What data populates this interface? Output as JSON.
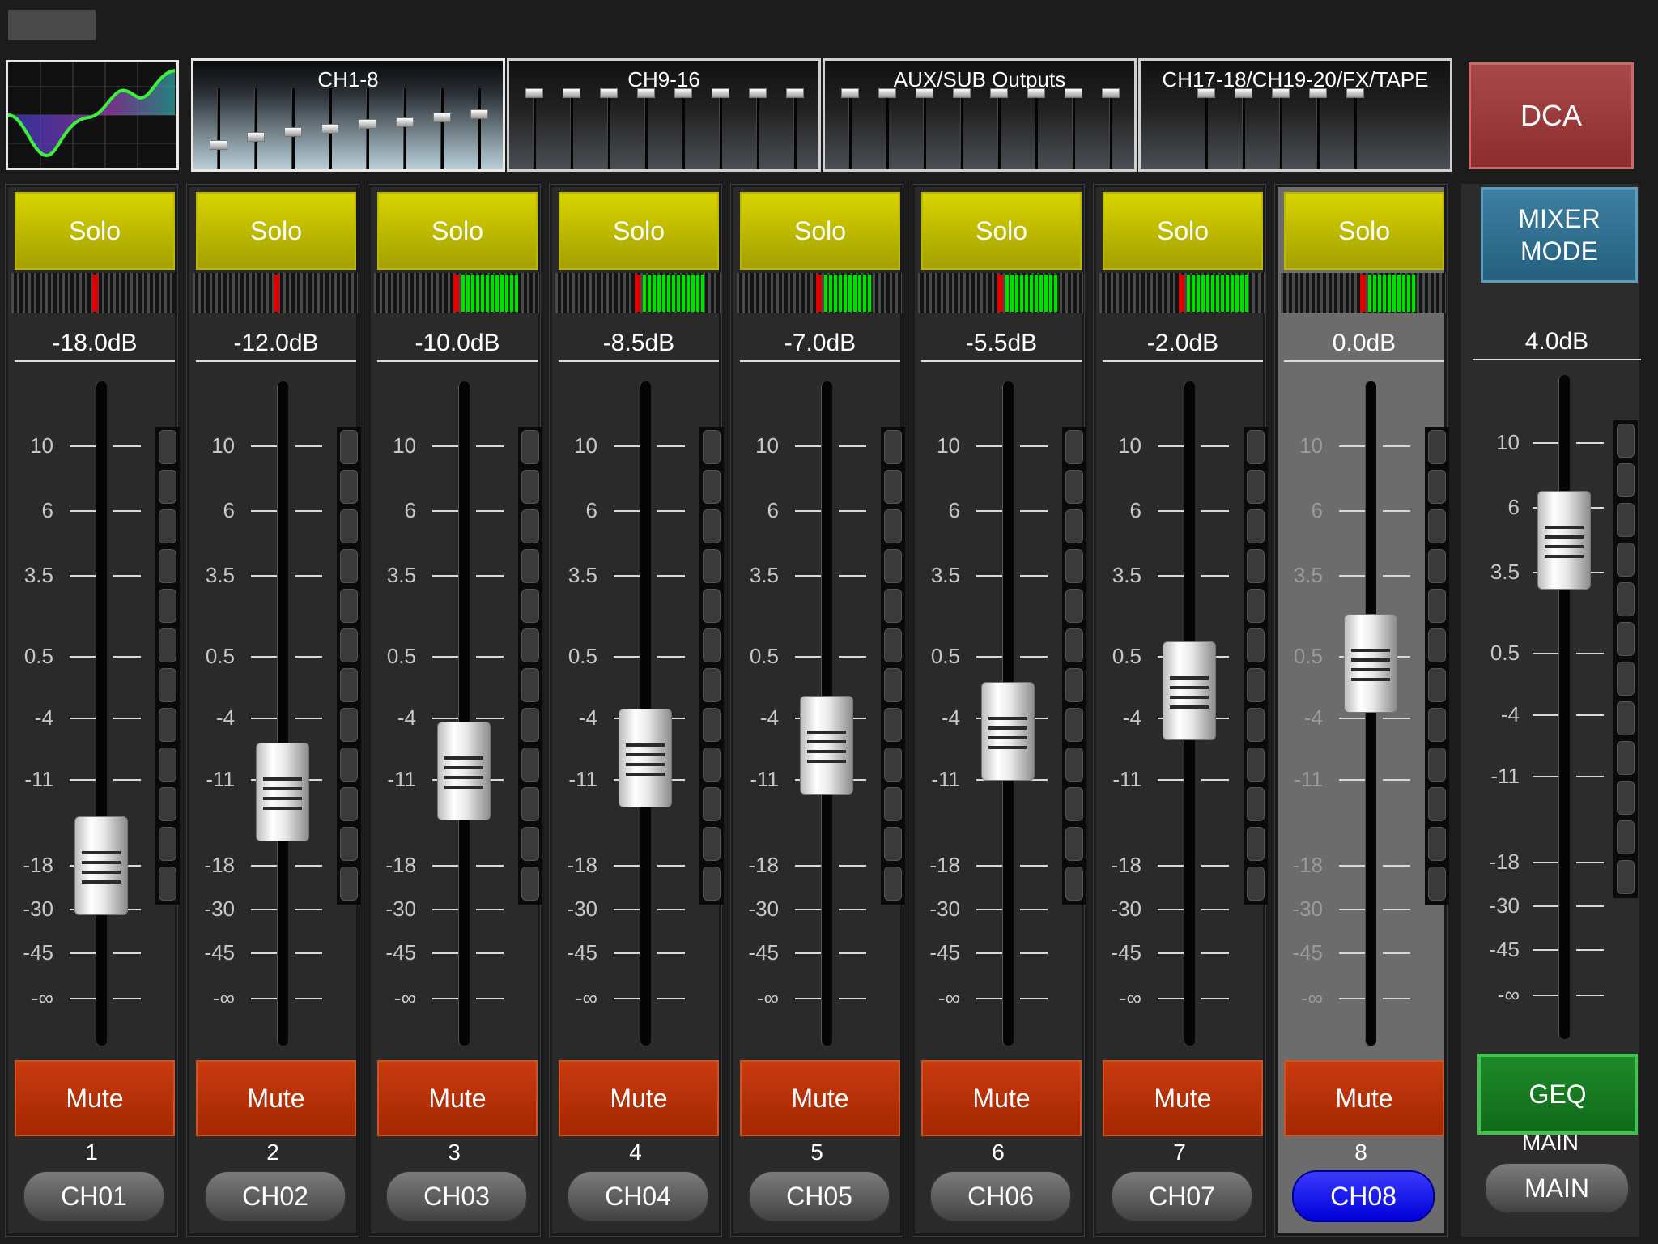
{
  "header": {
    "eq_thumbnail_icon": "eq-curve-icon",
    "banks": [
      "CH1-8",
      "CH9-16",
      "AUX/SUB Outputs",
      "CH17-18/CH19-20/FX/TAPE"
    ],
    "active_bank": 0,
    "dca_label": "DCA"
  },
  "scale": [
    "10",
    "6",
    "3.5",
    "0.5",
    "-4",
    "-11",
    "-18",
    "-30",
    "-45",
    "-∞"
  ],
  "colors": {
    "solo": "#c8c400",
    "mute": "#b83000",
    "selected_channel": "#0000ff",
    "meter_level": "#00e000",
    "peak": "#e00000",
    "mixer_mode": "#2f6f90",
    "geq": "#1a7c26",
    "dca": "#9c3a3a"
  },
  "channels": [
    {
      "solo": "Solo",
      "db": "-18.0dB",
      "mute": "Mute",
      "number": "1",
      "name": "CH01",
      "fader_db": -18.0,
      "meter_fraction": 0.0,
      "selected": false
    },
    {
      "solo": "Solo",
      "db": "-12.0dB",
      "mute": "Mute",
      "number": "2",
      "name": "CH02",
      "fader_db": -12.0,
      "meter_fraction": 0.0,
      "selected": false
    },
    {
      "solo": "Solo",
      "db": "-10.0dB",
      "mute": "Mute",
      "number": "3",
      "name": "CH03",
      "fader_db": -10.0,
      "meter_fraction": 0.35,
      "selected": false
    },
    {
      "solo": "Solo",
      "db": "-8.5dB",
      "mute": "Mute",
      "number": "4",
      "name": "CH04",
      "fader_db": -8.5,
      "meter_fraction": 0.38,
      "selected": false
    },
    {
      "solo": "Solo",
      "db": "-7.0dB",
      "mute": "Mute",
      "number": "5",
      "name": "CH05",
      "fader_db": -7.0,
      "meter_fraction": 0.3,
      "selected": false
    },
    {
      "solo": "Solo",
      "db": "-5.5dB",
      "mute": "Mute",
      "number": "6",
      "name": "CH06",
      "fader_db": -5.5,
      "meter_fraction": 0.33,
      "selected": false
    },
    {
      "solo": "Solo",
      "db": "-2.0dB",
      "mute": "Mute",
      "number": "7",
      "name": "CH07",
      "fader_db": -2.0,
      "meter_fraction": 0.38,
      "selected": false
    },
    {
      "solo": "Solo",
      "db": "0.0dB",
      "mute": "Mute",
      "number": "8",
      "name": "CH08",
      "fader_db": 0.0,
      "meter_fraction": 0.3,
      "selected": true
    }
  ],
  "master": {
    "mixer_mode_line1": "MIXER",
    "mixer_mode_line2": "MODE",
    "db": "4.0dB",
    "fader_db": 4.0,
    "geq_label": "GEQ",
    "main_label": "MAIN",
    "main_button": "MAIN"
  }
}
